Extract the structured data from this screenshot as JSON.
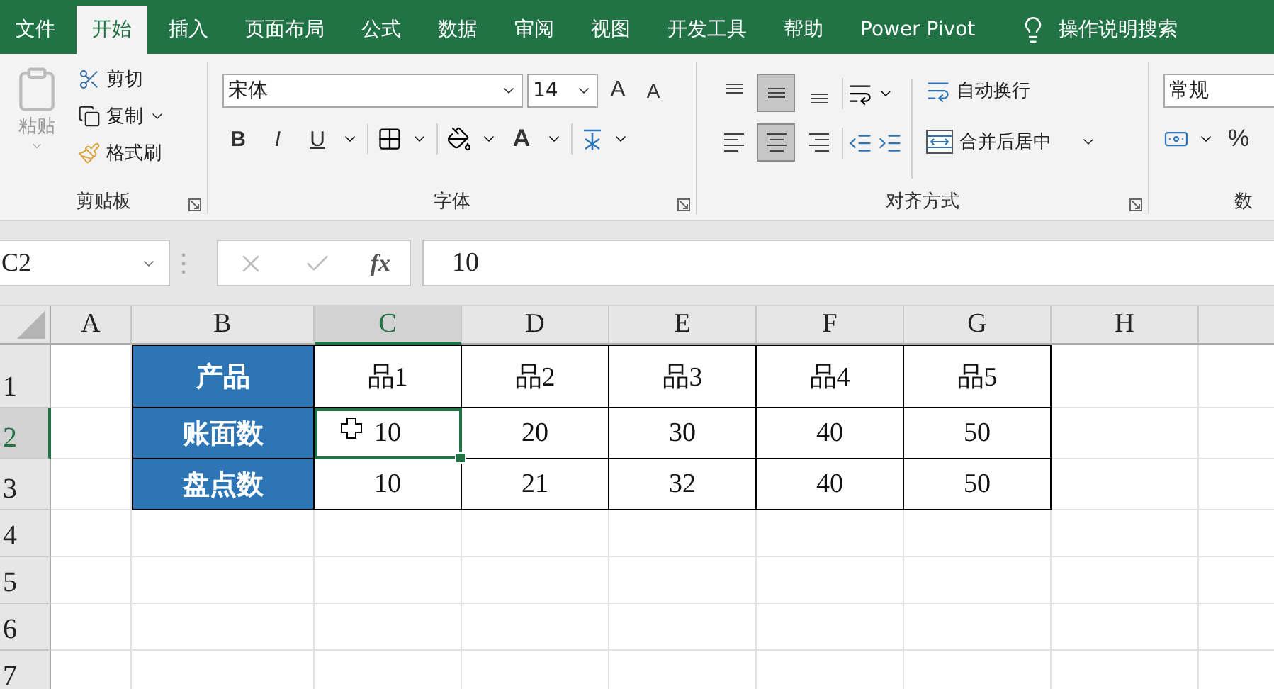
{
  "tabs": [
    {
      "label": "文件",
      "selected": false
    },
    {
      "label": "开始",
      "selected": true
    },
    {
      "label": "插入",
      "selected": false
    },
    {
      "label": "页面布局",
      "selected": false
    },
    {
      "label": "公式",
      "selected": false
    },
    {
      "label": "数据",
      "selected": false
    },
    {
      "label": "审阅",
      "selected": false
    },
    {
      "label": "视图",
      "selected": false
    },
    {
      "label": "开发工具",
      "selected": false
    },
    {
      "label": "帮助",
      "selected": false
    },
    {
      "label": "Power Pivot",
      "selected": false
    }
  ],
  "tell_me": {
    "label": "操作说明搜索"
  },
  "ribbon": {
    "clipboard": {
      "paste": "粘贴",
      "cut": "剪切",
      "copy": "复制",
      "format_painter": "格式刷",
      "label": "剪贴板"
    },
    "font": {
      "font_name": "宋体",
      "font_size": "14",
      "grow": "A",
      "shrink": "A",
      "bold": "B",
      "italic": "I",
      "underline": "U",
      "font_color": "A",
      "label": "字体"
    },
    "alignment": {
      "top_row": [
        {
          "kind": "top",
          "selected": false
        },
        {
          "kind": "middle",
          "selected": true
        },
        {
          "kind": "bottom",
          "selected": false
        }
      ],
      "bottom_row": [
        {
          "kind": "left",
          "selected": false
        },
        {
          "kind": "center",
          "selected": true
        },
        {
          "kind": "right",
          "selected": false
        }
      ],
      "wrap_text": "自动换行",
      "merge_center": "合并后居中",
      "label": "对齐方式"
    },
    "number": {
      "format": "常规",
      "percent": "%",
      "label": "数"
    }
  },
  "formula_bar": {
    "name_box": "C2",
    "function": "fx",
    "value": "10"
  },
  "sheet": {
    "columns": [
      {
        "label": "A",
        "selected": false
      },
      {
        "label": "B",
        "selected": false
      },
      {
        "label": "C",
        "selected": true
      },
      {
        "label": "D",
        "selected": false
      },
      {
        "label": "E",
        "selected": false
      },
      {
        "label": "F",
        "selected": false
      },
      {
        "label": "G",
        "selected": false
      },
      {
        "label": "H",
        "selected": false
      }
    ],
    "rows": [
      {
        "label": "1",
        "selected": false,
        "cells": [
          {
            "text": "产品",
            "kind": "label",
            "selected": false
          },
          {
            "text": "品1",
            "kind": "value",
            "selected": false
          },
          {
            "text": "品2",
            "kind": "value",
            "selected": false
          },
          {
            "text": "品3",
            "kind": "value",
            "selected": false
          },
          {
            "text": "品4",
            "kind": "value",
            "selected": false
          },
          {
            "text": "品5",
            "kind": "value",
            "selected": false
          }
        ]
      },
      {
        "label": "2",
        "selected": true,
        "cells": [
          {
            "text": "账面数",
            "kind": "label",
            "selected": false
          },
          {
            "text": "10",
            "kind": "value",
            "selected": true
          },
          {
            "text": "20",
            "kind": "value",
            "selected": false
          },
          {
            "text": "30",
            "kind": "value",
            "selected": false
          },
          {
            "text": "40",
            "kind": "value",
            "selected": false
          },
          {
            "text": "50",
            "kind": "value",
            "selected": false
          }
        ]
      },
      {
        "label": "3",
        "selected": false,
        "cells": [
          {
            "text": "盘点数",
            "kind": "label",
            "selected": false
          },
          {
            "text": "10",
            "kind": "value",
            "selected": false
          },
          {
            "text": "21",
            "kind": "value",
            "selected": false
          },
          {
            "text": "32",
            "kind": "value",
            "selected": false
          },
          {
            "text": "40",
            "kind": "value",
            "selected": false
          },
          {
            "text": "50",
            "kind": "value",
            "selected": false
          }
        ]
      },
      {
        "label": "4",
        "selected": false
      },
      {
        "label": "5",
        "selected": false
      },
      {
        "label": "6",
        "selected": false
      },
      {
        "label": "7",
        "selected": false
      }
    ]
  }
}
